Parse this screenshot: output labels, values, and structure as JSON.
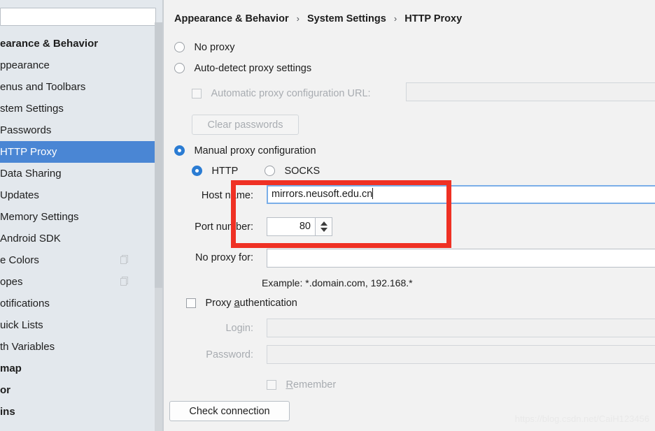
{
  "sidebar": {
    "search": {
      "value": "",
      "placeholder": ""
    },
    "items": [
      {
        "label": "earance & Behavior",
        "group": true,
        "selected": false,
        "copy": false
      },
      {
        "label": "ppearance",
        "group": false,
        "selected": false,
        "copy": false
      },
      {
        "label": "enus and Toolbars",
        "group": false,
        "selected": false,
        "copy": false
      },
      {
        "label": "stem Settings",
        "group": false,
        "selected": false,
        "copy": false
      },
      {
        "label": "Passwords",
        "group": false,
        "selected": false,
        "copy": false
      },
      {
        "label": "HTTP Proxy",
        "group": false,
        "selected": true,
        "copy": false
      },
      {
        "label": "Data Sharing",
        "group": false,
        "selected": false,
        "copy": false
      },
      {
        "label": "Updates",
        "group": false,
        "selected": false,
        "copy": false
      },
      {
        "label": "Memory Settings",
        "group": false,
        "selected": false,
        "copy": false
      },
      {
        "label": "Android SDK",
        "group": false,
        "selected": false,
        "copy": false
      },
      {
        "label": "e Colors",
        "group": false,
        "selected": false,
        "copy": true
      },
      {
        "label": "opes",
        "group": false,
        "selected": false,
        "copy": true
      },
      {
        "label": "otifications",
        "group": false,
        "selected": false,
        "copy": false
      },
      {
        "label": "uick Lists",
        "group": false,
        "selected": false,
        "copy": false
      },
      {
        "label": "th Variables",
        "group": false,
        "selected": false,
        "copy": false
      },
      {
        "label": "map",
        "group": true,
        "selected": false,
        "copy": false
      },
      {
        "label": "or",
        "group": true,
        "selected": false,
        "copy": false
      },
      {
        "label": "ins",
        "group": true,
        "selected": false,
        "copy": false
      }
    ]
  },
  "breadcrumb": {
    "part1": "Appearance & Behavior",
    "sep1": "›",
    "part2": "System Settings",
    "sep2": "›",
    "part3": "HTTP Proxy"
  },
  "form": {
    "no_proxy_label": "No proxy",
    "auto_detect_label": "Auto-detect proxy settings",
    "pac_checkbox_label": "Automatic proxy configuration URL:",
    "pac_value": "",
    "clear_passwords_label": "Clear passwords",
    "manual_label": "Manual proxy configuration",
    "http_label": "HTTP",
    "socks_label": "SOCKS",
    "host_name_label": "Host name:",
    "host_name_value": "mirrors.neusoft.edu.cn",
    "port_number_label": "Port number:",
    "port_number_value": "80",
    "no_proxy_for_label": "No proxy for:",
    "no_proxy_for_value": "",
    "example_hint": "Example: *.domain.com, 192.168.*",
    "proxy_auth_label_pre": "Proxy ",
    "proxy_auth_label_mnemonic": "a",
    "proxy_auth_label_post": "uthentication",
    "login_label": "Login:",
    "login_value": "",
    "password_label": "Password:",
    "password_value": "",
    "remember_label_mnemonic": "R",
    "remember_label_post": "emember",
    "check_connection_label": "Check connection"
  },
  "watermark": {
    "text": "https://blog.csdn.net/CaiH123456"
  },
  "colors": {
    "selection_blue": "#4a86d4",
    "radio_blue": "#2b7cd3",
    "annotation_red": "#ef3124",
    "sidebar_bg": "#e3e8ed",
    "panel_bg": "#f2f2f2",
    "focus_border": "#7aaee8"
  }
}
